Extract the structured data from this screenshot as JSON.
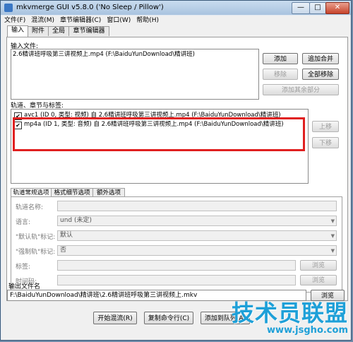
{
  "window": {
    "title": "mkvmerge GUI v5.8.0 ('No Sleep / Pillow')",
    "minimize": "—",
    "maximize": "□",
    "close": "✕"
  },
  "menu": [
    "文件(F)",
    "混流(M)",
    "章节编辑器(C)",
    "窗口(W)",
    "帮助(H)"
  ],
  "tabs": [
    "输入",
    "附件",
    "全局",
    "章节编辑器"
  ],
  "input": {
    "section_label": "输入文件:",
    "files": [
      "2.6精讲班呼吸第三讲视频上.mp4 (F:\\BaiduYunDownload\\精讲班)"
    ],
    "add_button": "添加",
    "append_button": "追加合并",
    "remove_button": "移除",
    "remove_all_button": "全部移除",
    "add_other_button": "添加其余部分"
  },
  "tracks": {
    "section_label": "轨道、章节与标签:",
    "items": [
      {
        "checked": "✔",
        "text": "avc1 (ID 0, 类型: 视频) 自 2.6精讲班呼吸第三讲视频上.mp4 (F:\\BaiduYunDownload\\精讲班)"
      },
      {
        "checked": "✔",
        "text": "mp4a (ID 1, 类型: 音频) 自 2.6精讲班呼吸第三讲视频上.mp4 (F:\\BaiduYunDownload\\精讲班)"
      }
    ],
    "up_button": "上移",
    "down_button": "下移"
  },
  "subtabs": [
    "轨道常规选项",
    "格式细节选项",
    "额外选项"
  ],
  "options": {
    "track_name_label": "轨道名称:",
    "language_label": "语言:",
    "language_value": "und (未定)",
    "default_label": "\"默认轨\"标记:",
    "default_value": "默认",
    "forced_label": "\"强制轨\"标记:",
    "forced_value": "否",
    "tags_label": "标签:",
    "tags_browse": "浏览",
    "timecodes_label": "时间码:",
    "timecodes_browse": "浏览"
  },
  "output": {
    "label": "输出文件名",
    "value": "F:\\BaiduYunDownload\\精讲班\\2.6精讲班呼吸第三讲视频上.mkv",
    "browse_button": "浏览"
  },
  "bottom": {
    "start_button": "开始混流(R)",
    "copy_button": "复制命令行(C)",
    "queue_button": "添加到队列(A)"
  },
  "watermark": {
    "text": "技术员联盟",
    "url": "www.jsgho.com"
  }
}
